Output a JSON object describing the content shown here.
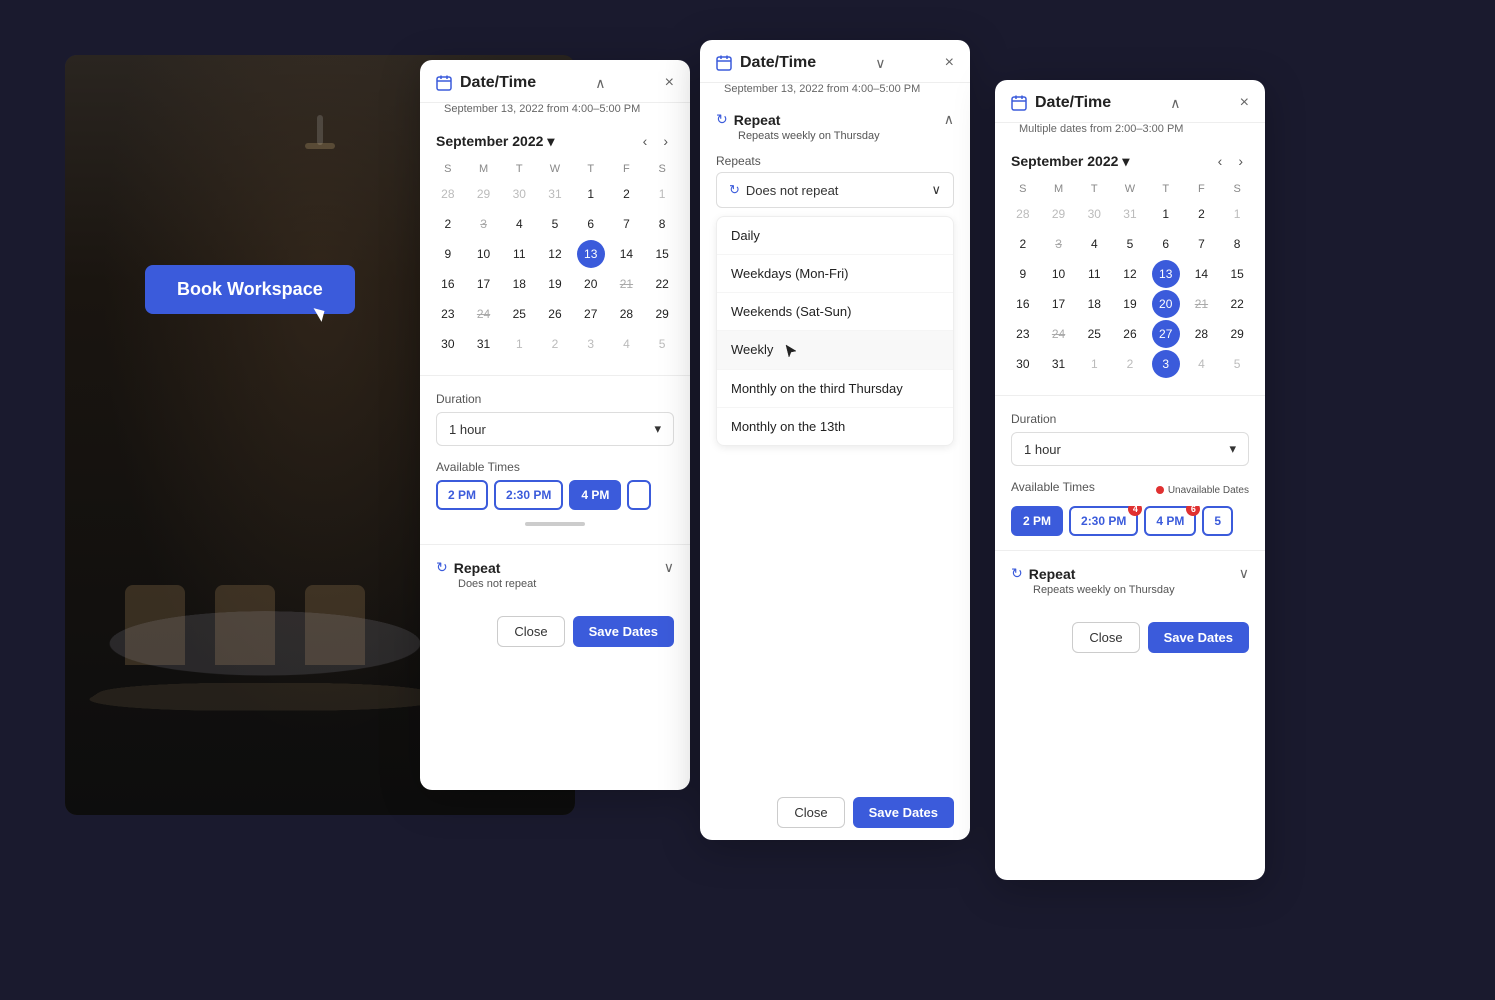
{
  "background": {
    "book_button": "Book Workspace"
  },
  "panel1": {
    "title": "Date/Time",
    "subtitle": "September 13, 2022 from 4:00–5:00 PM",
    "close": "×",
    "chevron_up": "∧",
    "month": "September 2022",
    "day_headers": [
      "S",
      "M",
      "T",
      "W",
      "T",
      "F",
      "S"
    ],
    "weeks": [
      [
        "28",
        "29",
        "30",
        "31",
        "1",
        "2",
        "1"
      ],
      [
        "2",
        "3",
        "4",
        "5",
        "6",
        "7",
        "8"
      ],
      [
        "9",
        "10",
        "11",
        "12",
        "13",
        "14",
        "15"
      ],
      [
        "16",
        "17",
        "18",
        "19",
        "20",
        "21",
        "22"
      ],
      [
        "23",
        "24",
        "25",
        "26",
        "27",
        "28",
        "29"
      ],
      [
        "30",
        "31",
        "1",
        "2",
        "3",
        "4",
        "5"
      ]
    ],
    "selected_day": "13",
    "duration_label": "Duration",
    "duration_value": "1 hour",
    "avail_label": "Available Times",
    "times": [
      "2 PM",
      "2:30 PM",
      "4 PM"
    ],
    "repeat_title": "Repeat",
    "repeat_subtitle": "Does not repeat",
    "close_btn": "Close",
    "save_btn": "Save Dates"
  },
  "panel2": {
    "title": "Date/Time",
    "subtitle": "September 13, 2022 from 4:00–5:00 PM",
    "close": "×",
    "chevron_up": "∧",
    "repeat_title": "Repeat",
    "repeat_subtitle": "Repeats weekly on Thursday",
    "repeats_label": "Repeats",
    "selected_repeat": "Does not repeat",
    "dropdown_items": [
      "Daily",
      "Weekdays (Mon-Fri)",
      "Weekends (Sat-Sun)",
      "Weekly",
      "Monthly on the third Thursday",
      "Monthly on the 13th"
    ],
    "hovered_item": "Weekly",
    "close_btn": "Close",
    "save_btn": "Save Dates"
  },
  "panel3": {
    "title": "Date/Time",
    "subtitle": "Multiple dates from 2:00–3:00 PM",
    "close": "×",
    "chevron_up": "∧",
    "month": "September 2022",
    "day_headers": [
      "S",
      "M",
      "T",
      "W",
      "T",
      "F",
      "S"
    ],
    "weeks": [
      [
        "28",
        "29",
        "30",
        "31",
        "1",
        "2",
        "1"
      ],
      [
        "2",
        "3",
        "4",
        "5",
        "6",
        "7",
        "8"
      ],
      [
        "9",
        "10",
        "11",
        "12",
        "13",
        "14",
        "15"
      ],
      [
        "16",
        "17",
        "18",
        "19",
        "20",
        "21",
        "22"
      ],
      [
        "23",
        "24",
        "25",
        "26",
        "27",
        "28",
        "29"
      ],
      [
        "30",
        "31",
        "1",
        "2",
        "3",
        "4",
        "5"
      ]
    ],
    "selected_days": [
      "13",
      "20",
      "27",
      "3"
    ],
    "duration_label": "Duration",
    "duration_value": "1 hour",
    "avail_label": "Available Times",
    "unavail_legend": "Unavailable Dates",
    "times": [
      "2 PM",
      "2:30 PM",
      "4 PM",
      "5"
    ],
    "time_badges": {
      "2:30 PM": "4",
      "4 PM": "6"
    },
    "repeat_title": "Repeat",
    "repeat_subtitle": "Repeats weekly on Thursday",
    "close_btn": "Close",
    "save_btn": "Save Dates"
  }
}
